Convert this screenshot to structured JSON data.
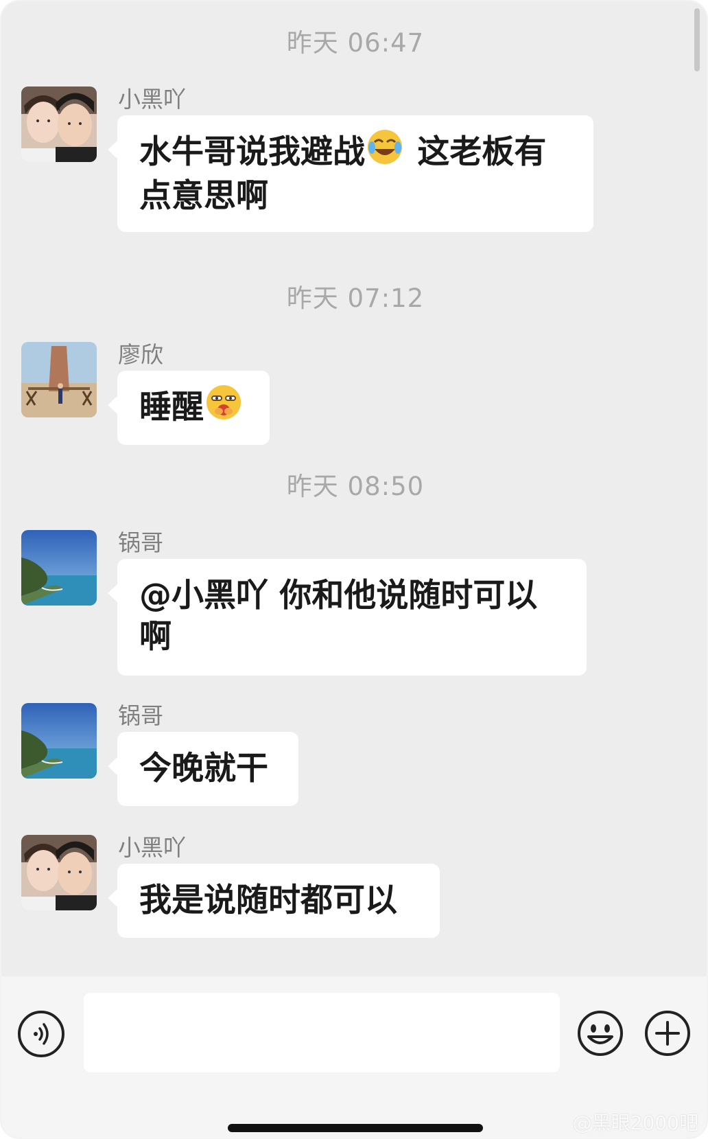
{
  "chat": {
    "timestamps": [
      "昨天 06:47",
      "昨天 07:12",
      "昨天 08:50"
    ],
    "messages": [
      {
        "sender": "小黑吖",
        "avatar": "couple-photo-avatar",
        "text_before_emoji": "水牛哥说我避战",
        "emoji": "laugh-cry-emoji",
        "text_after_emoji": " 这老板有",
        "text_line2": "点意思啊"
      },
      {
        "sender": "廖欣",
        "avatar": "monument-photo-avatar",
        "text": "睡醒",
        "emoji": "sleepy-emoji"
      },
      {
        "sender": "锅哥",
        "avatar": "coastline-photo-avatar",
        "text": "@小黑吖 你和他说随时可以",
        "text_line2": "啊"
      },
      {
        "sender": "锅哥",
        "avatar": "coastline-photo-avatar",
        "text": "今晚就干"
      },
      {
        "sender": "小黑吖",
        "avatar": "couple-photo-avatar",
        "text": "我是说随时都可以"
      }
    ]
  },
  "input_bar": {
    "value": "",
    "voice_icon": "voice-icon",
    "emoji_icon": "smiley-icon",
    "plus_icon": "plus-icon"
  },
  "watermark": "@黑眼2000吧"
}
